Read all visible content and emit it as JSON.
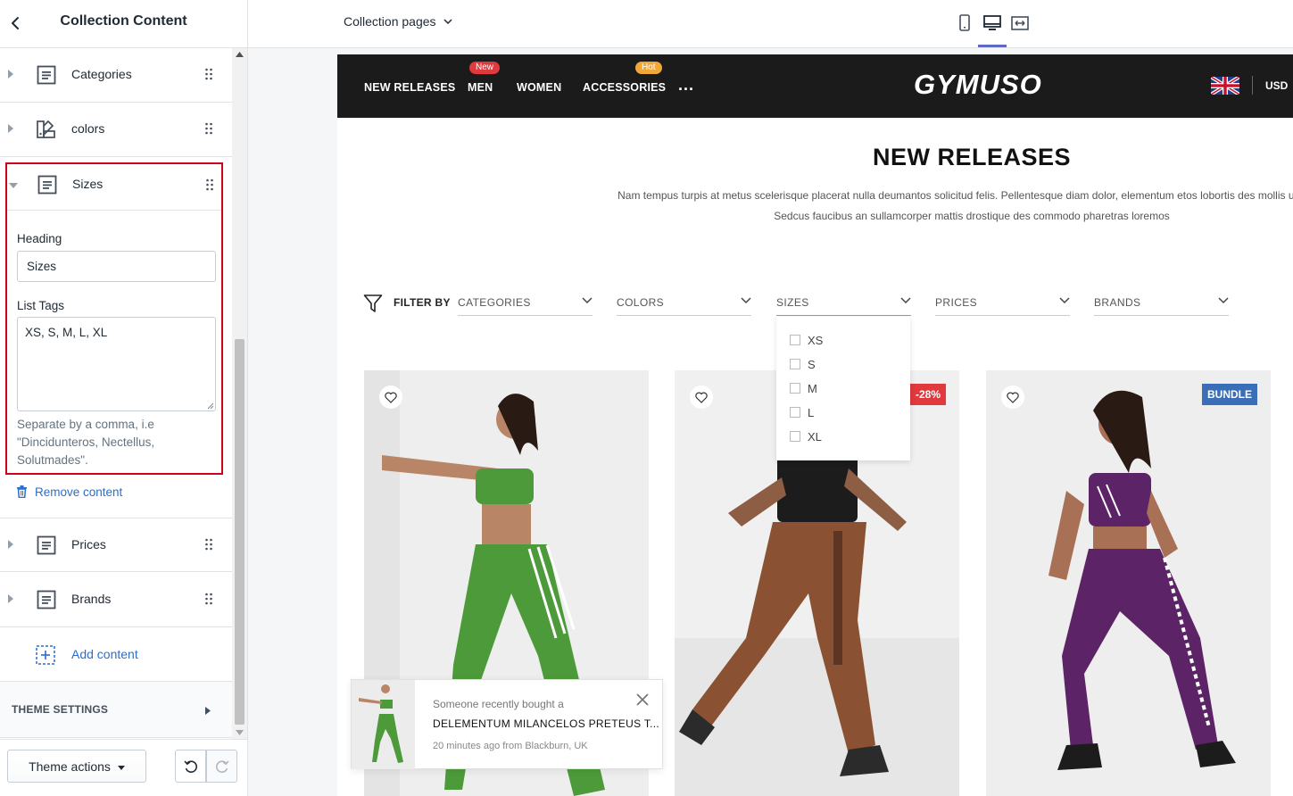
{
  "editor": {
    "title": "Collection Content",
    "blocks": [
      {
        "label": "Categories",
        "icon": "text-block-icon"
      },
      {
        "label": "colors",
        "icon": "color-swatch-icon"
      },
      {
        "label": "Sizes",
        "icon": "text-block-icon"
      },
      {
        "label": "Prices",
        "icon": "text-block-icon"
      },
      {
        "label": "Brands",
        "icon": "text-block-icon"
      }
    ],
    "sizes_block": {
      "heading_label": "Heading",
      "heading_value": "Sizes",
      "tags_label": "List Tags",
      "tags_value": "XS, S, M, L, XL",
      "help_text": "Separate by a comma, i.e \"Dincidunteros, Nectellus, Solutmades\"."
    },
    "remove_content": "Remove content",
    "add_content": "Add content",
    "theme_settings": "THEME SETTINGS",
    "theme_actions": "Theme actions"
  },
  "topbar": {
    "page_select": "Collection pages",
    "viewports": [
      "mobile-icon",
      "desktop-icon",
      "fullwidth-icon"
    ],
    "active_viewport": "desktop"
  },
  "store": {
    "nav": [
      {
        "label": "NEW RELEASES",
        "badge": ""
      },
      {
        "label": "MEN",
        "badge": "New"
      },
      {
        "label": "WOMEN",
        "badge": ""
      },
      {
        "label": "ACCESSORIES",
        "badge": "Hot"
      }
    ],
    "more": "...",
    "logo": "GYMUSO",
    "currency": "USD",
    "badge_colors": {
      "new": "#e0393e",
      "hot": "#f0a73a"
    },
    "collection_title": "NEW RELEASES",
    "description_line1": "Nam tempus turpis at metus scelerisque placerat nulla deumantos solicitud felis. Pellentesque diam dolor, elementum etos lobortis des mollis ut risus.",
    "description_line2": "Sedcus faucibus an sullamcorper mattis drostique des commodo pharetras loremos",
    "filter_by": "FILTER BY",
    "filters": [
      "CATEGORIES",
      "COLORS",
      "SIZES",
      "PRICES",
      "BRANDS"
    ],
    "size_options": [
      "XS",
      "S",
      "M",
      "L",
      "XL"
    ],
    "products": [
      {
        "label": "",
        "outfit_color": "#4c9a3a"
      },
      {
        "label": "-28%",
        "label_color": "#e0393e",
        "outfit_color": "#8a5233"
      },
      {
        "label": "BUNDLE",
        "label_color": "#3a6fb7",
        "outfit_color": "#5c2466"
      }
    ],
    "toast": {
      "line1": "Someone recently bought a",
      "line2": "DELEMENTUM MILANCELOS PRETEUS T...",
      "line3": "20 minutes ago from Blackburn, UK"
    }
  }
}
